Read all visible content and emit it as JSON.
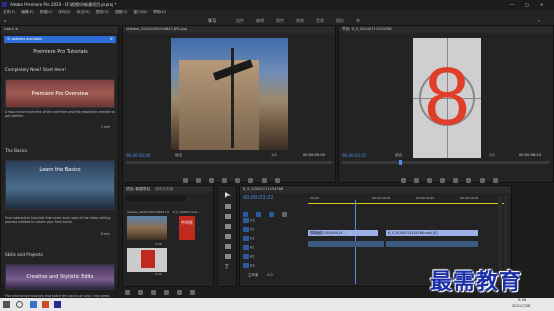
{
  "app": {
    "title": "Adobe Premiere Pro 2020 - D:\\视频\\0\\新建项目.prproj *"
  },
  "menu": [
    "文件(F)",
    "编辑(E)",
    "剪辑(C)",
    "序列(S)",
    "标记(M)",
    "图形(G)",
    "视图(V)",
    "窗口(W)",
    "帮助(H)"
  ],
  "workspaces": [
    "学习",
    "组件",
    "编辑",
    "颜色",
    "效果",
    "音频",
    "图形",
    "库"
  ],
  "learn": {
    "tab": "Learn ≡",
    "updates": "4 updates available",
    "heading": "Premiere Pro Tutorials",
    "section1": "Completely New? Start Here!",
    "card1": "Premiere Pro Overview",
    "card1_desc": "A two-minute overview of the interface and the essentials needed to get started.",
    "card1_time": "2 min",
    "section2": "The Basics",
    "card2": "Learn the Basics",
    "card2_desc": "Four interactive tutorials that cover each step of the video editing process needed to create your first movie.",
    "card2_time": "8 min",
    "section3": "Skills and Projects",
    "card3": "Creative and Stylistic Edits",
    "card3_desc": "Five interactive tutorials that teach the basics of color, clip speed, adding titles and transitions, adjusting audio and color correction."
  },
  "source": {
    "tab": "release_20201001004847.JPG.jpg",
    "timecode": "00:00:00:00",
    "zoom": "适合",
    "ratio": "1/2",
    "duration": "00:00:05:00"
  },
  "program": {
    "tab": "节目: 6_5_20200711254766",
    "timecode": "00:00:03:22",
    "zoom": "适合",
    "ratio": "1/2",
    "duration": "00:00:06:23",
    "countdown": "8"
  },
  "project": {
    "tab": "项目: 新建项目",
    "tab2": "媒体浏览器",
    "file1": "release_20201001004847.JPG",
    "file2": "6_5_202007112...",
    "dur1": "5:00",
    "dur2": "0:00",
    "seal": "中华秋"
  },
  "timeline": {
    "tab": "6_5_20200711254766",
    "timecode": "00:00:03:22",
    "ruler": [
      "00:00",
      "00:00:04:29",
      "00:00:09:29",
      "00:00:14:29"
    ],
    "tracks": [
      "V3",
      "V2",
      "V1",
      "A1",
      "A2",
      "A3",
      "主声道"
    ],
    "clip1": "屏幕截图 2020/09/14 ...",
    "clip2": "6_5_20200711254766.mp4 [V]",
    "master": "0.0"
  },
  "watermark": "最需教育",
  "taskbar": {
    "time": "9:26",
    "date": "2021/7/28"
  }
}
